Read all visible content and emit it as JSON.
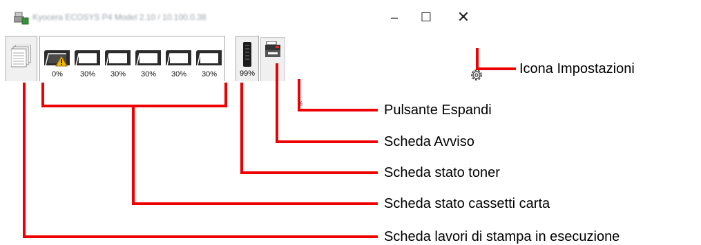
{
  "window": {
    "title": "Kyocera ECOSYS P4 Model 2.10 / 10.100.0.38",
    "controls": {
      "minimize": "–",
      "maximize": "☐",
      "close": "✕"
    }
  },
  "paper_trays": [
    {
      "name": "tray-1",
      "level": "0%",
      "warning": true
    },
    {
      "name": "tray-2",
      "level": "30%",
      "warning": false
    },
    {
      "name": "tray-3",
      "level": "30%",
      "warning": false
    },
    {
      "name": "tray-4",
      "level": "30%",
      "warning": false
    },
    {
      "name": "tray-5",
      "level": "30%",
      "warning": false
    },
    {
      "name": "tray-6",
      "level": "30%",
      "warning": false
    }
  ],
  "toner": {
    "level": "99%"
  },
  "expand_glyph": "≚",
  "callouts": {
    "settings": "Icona Impostazioni",
    "expand": "Pulsante Espandi",
    "alert": "Scheda Avviso",
    "toner": "Scheda stato toner",
    "paper": "Scheda stato cassetti carta",
    "jobs": "Scheda lavori di stampa in esecuzione"
  },
  "colors": {
    "callout_line": "#ee0000",
    "tab_border": "#a9a9a9"
  },
  "icons": [
    "printer-app-icon",
    "document-stack-icon",
    "paper-tray-icon",
    "warning-icon",
    "toner-cartridge-icon",
    "multifunction-printer-icon",
    "gear-icon"
  ]
}
